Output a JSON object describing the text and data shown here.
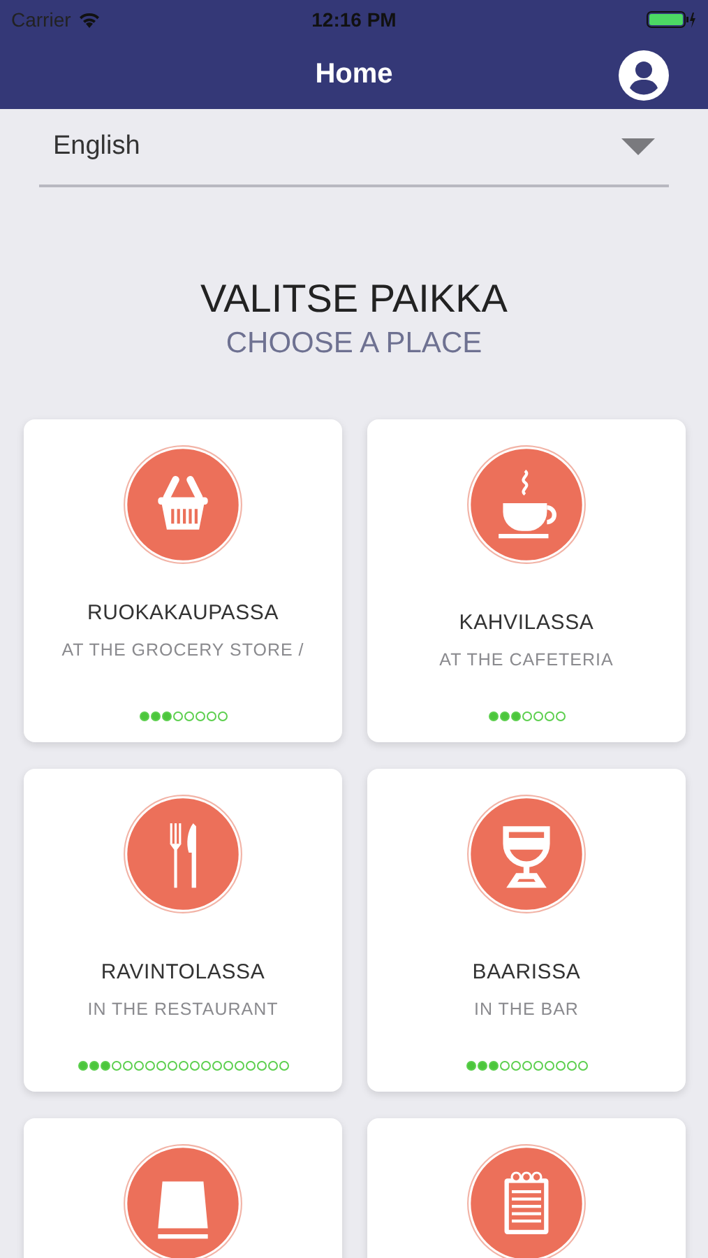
{
  "status_bar": {
    "carrier": "Carrier",
    "time": "12:16 PM"
  },
  "nav_bar": {
    "title": "Home"
  },
  "language_select": {
    "value": "English"
  },
  "heading": {
    "title": "VALITSE PAIKKA",
    "subtitle": "CHOOSE A PLACE"
  },
  "places": [
    {
      "kind": "full",
      "title": "RUOKAKAUPASSA",
      "subtitle": "AT THE GROCERY STORE /",
      "steps": [
        {
          "completed": true
        },
        {
          "completed": true
        },
        {
          "completed": true
        },
        {
          "completed": false
        },
        {
          "completed": false
        },
        {
          "completed": false
        },
        {
          "completed": false
        },
        {
          "completed": false
        }
      ]
    },
    {
      "kind": "full",
      "title": "KAHVILASSA",
      "subtitle": "AT THE CAFETERIA",
      "steps": [
        {
          "completed": true
        },
        {
          "completed": true
        },
        {
          "completed": true
        },
        {
          "completed": false
        },
        {
          "completed": false
        },
        {
          "completed": false
        },
        {
          "completed": false
        }
      ]
    },
    {
      "kind": "full",
      "title": "RAVINTOLASSA",
      "subtitle": "IN THE RESTAURANT",
      "steps": [
        {
          "completed": true
        },
        {
          "completed": true
        },
        {
          "completed": true
        },
        {
          "completed": false
        },
        {
          "completed": false
        },
        {
          "completed": false
        },
        {
          "completed": false
        },
        {
          "completed": false
        },
        {
          "completed": false
        },
        {
          "completed": false
        },
        {
          "completed": false
        },
        {
          "completed": false
        },
        {
          "completed": false
        },
        {
          "completed": false
        },
        {
          "completed": false
        },
        {
          "completed": false
        },
        {
          "completed": false
        },
        {
          "completed": false
        },
        {
          "completed": false
        }
      ]
    },
    {
      "kind": "full",
      "title": "BAARISSA",
      "subtitle": "IN THE BAR",
      "steps": [
        {
          "completed": true
        },
        {
          "completed": true
        },
        {
          "completed": true
        },
        {
          "completed": false
        },
        {
          "completed": false
        },
        {
          "completed": false
        },
        {
          "completed": false
        },
        {
          "completed": false
        },
        {
          "completed": false
        },
        {
          "completed": false
        },
        {
          "completed": false
        }
      ]
    },
    {
      "kind": "cut_off"
    },
    {
      "kind": "cut_off"
    }
  ]
}
